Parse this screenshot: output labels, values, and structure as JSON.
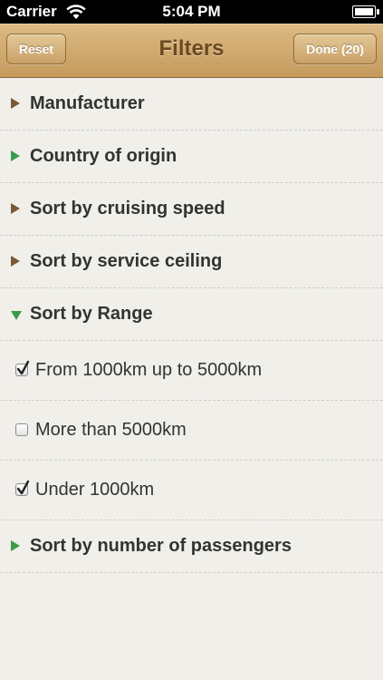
{
  "status_bar": {
    "carrier": "Carrier",
    "time": "5:04 PM"
  },
  "nav": {
    "title": "Filters",
    "reset_label": "Reset",
    "done_label": "Done (20)"
  },
  "sections": [
    {
      "label": "Manufacturer",
      "state": "collapsed"
    },
    {
      "label": "Country of origin",
      "state": "collapsed-highlighted"
    },
    {
      "label": "Sort by cruising speed",
      "state": "collapsed"
    },
    {
      "label": "Sort by service ceiling",
      "state": "collapsed"
    },
    {
      "label": "Sort by Range",
      "state": "expanded",
      "options": [
        {
          "label": "From 1000km up to 5000km",
          "checked": true
        },
        {
          "label": "More than 5000km",
          "checked": false
        },
        {
          "label": "Under 1000km",
          "checked": true
        }
      ]
    },
    {
      "label": "Sort by number of passengers",
      "state": "collapsed-highlighted"
    }
  ],
  "colors": {
    "nav_title": "#6b4a20",
    "arrow_brown": "#7a5a32",
    "arrow_green": "#3a9a4a",
    "background": "#f0efea"
  }
}
